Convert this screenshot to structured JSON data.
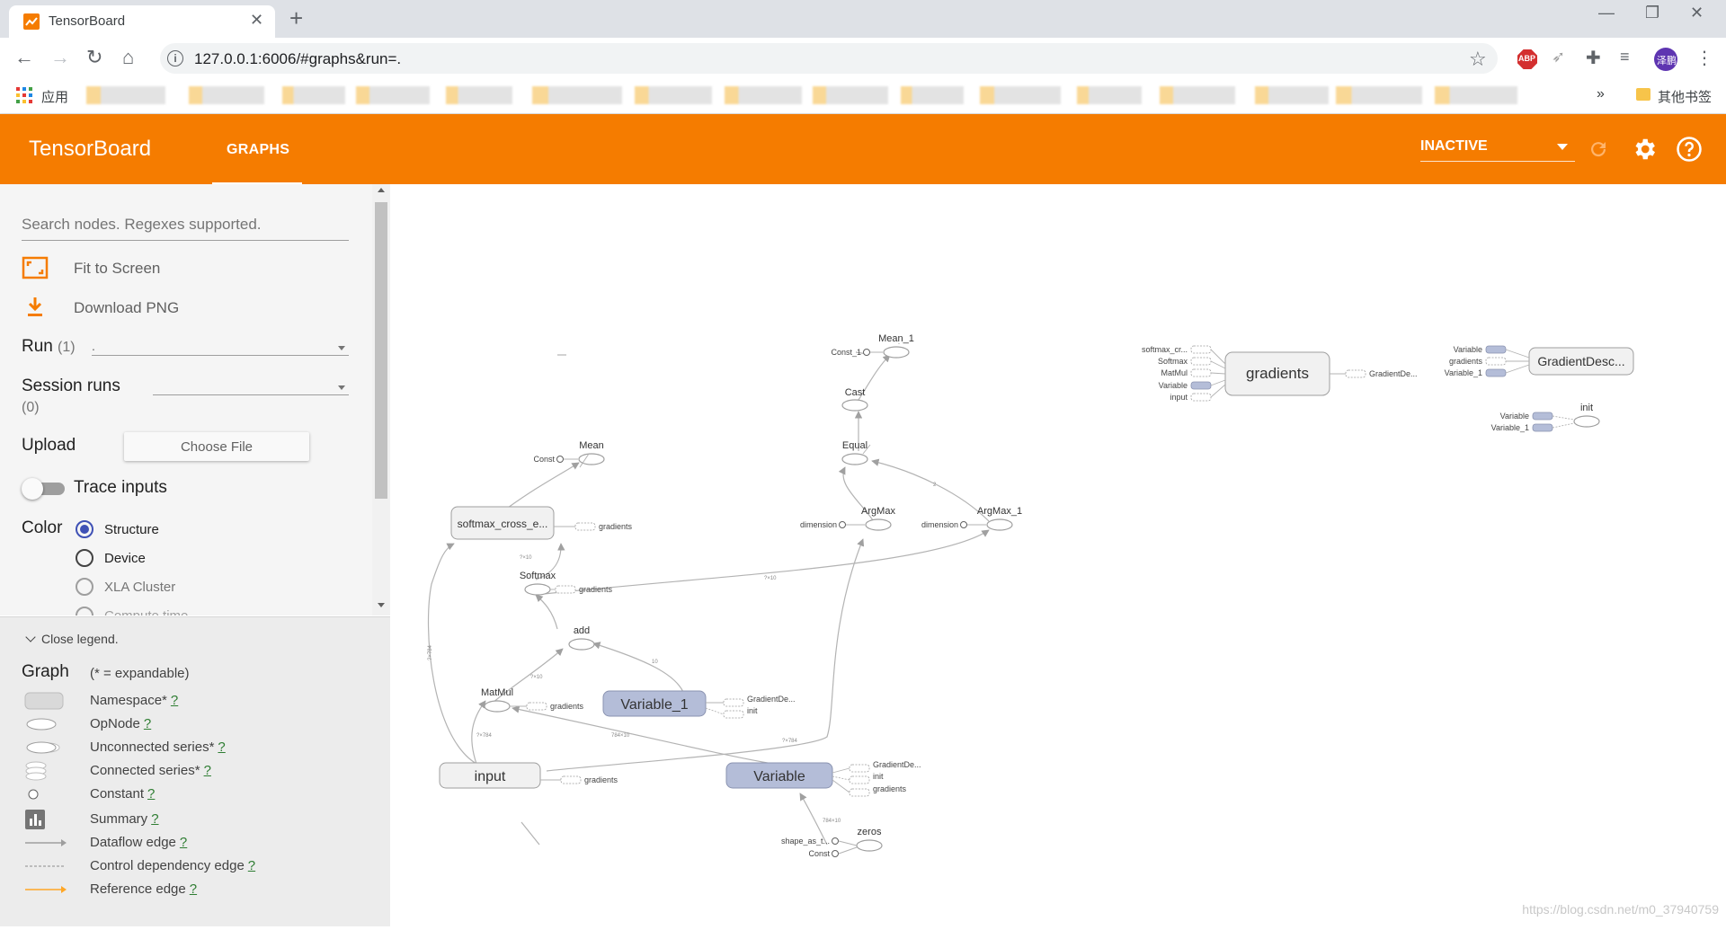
{
  "browser": {
    "tab_title": "TensorBoard",
    "url": "127.0.0.1:6006/#graphs&run=.",
    "bookmarks_apps_label": "应用",
    "bookmarks_other_label": "其他书签",
    "profile_label": "泽鹏",
    "ext_label": "ABP"
  },
  "header": {
    "title": "TensorBoard",
    "tab_label": "GRAPHS",
    "run_status": "INACTIVE"
  },
  "sidebar": {
    "search_placeholder": "Search nodes. Regexes supported.",
    "fit_label": "Fit to Screen",
    "download_label": "Download PNG",
    "run_label": "Run",
    "run_count": "(1)",
    "run_value": ".",
    "session_label": "Session runs",
    "session_count": "(0)",
    "upload_label": "Upload",
    "choose_file_label": "Choose File",
    "trace_label": "Trace inputs",
    "color_label": "Color",
    "color_options": [
      "Structure",
      "Device",
      "XLA Cluster",
      "Compute time"
    ],
    "color_selected": "Structure"
  },
  "legend": {
    "close_label": "Close legend.",
    "graph_label": "Graph",
    "expandable_note": "(* = expandable)",
    "help_mark": "?",
    "items": [
      "Namespace*",
      "OpNode",
      "Unconnected series*",
      "Connected series*",
      "Constant",
      "Summary",
      "Dataflow edge",
      "Control dependency edge",
      "Reference edge"
    ]
  },
  "graph": {
    "nodes": {
      "input": "input",
      "variable": "Variable",
      "variable_1": "Variable_1",
      "softmax_cross": "softmax_cross_e...",
      "gradients": "gradients",
      "gradient_desc": "GradientDesc...",
      "mean": "Mean",
      "mean_1": "Mean_1",
      "const": "Const",
      "const_1": "Const_1",
      "cast": "Cast",
      "equal": "Equal",
      "argmax": "ArgMax",
      "argmax_1": "ArgMax_1",
      "dimension": "dimension",
      "softmax": "Softmax",
      "add": "add",
      "matmul": "MatMul",
      "zeros": "zeros",
      "shape_as_t": "shape_as_t...",
      "init": "init",
      "gradient_de": "GradientDe..."
    },
    "aux_labels": {
      "gradients": "gradients",
      "init": "init",
      "softmax_cr": "softmax_cr...",
      "softmax": "Softmax",
      "matmul": "MatMul",
      "variable": "Variable",
      "input": "input",
      "variable_1": "Variable_1"
    },
    "edge_labels": {
      "e1": "?×10",
      "e2": "?×784",
      "e3": "784×10",
      "e4": "?×10",
      "e5": "10",
      "e6": "?×10",
      "e7": "?×784",
      "e8": "784×10",
      "e9": "2"
    }
  },
  "watermark": "https://blog.csdn.net/m0_37940759"
}
